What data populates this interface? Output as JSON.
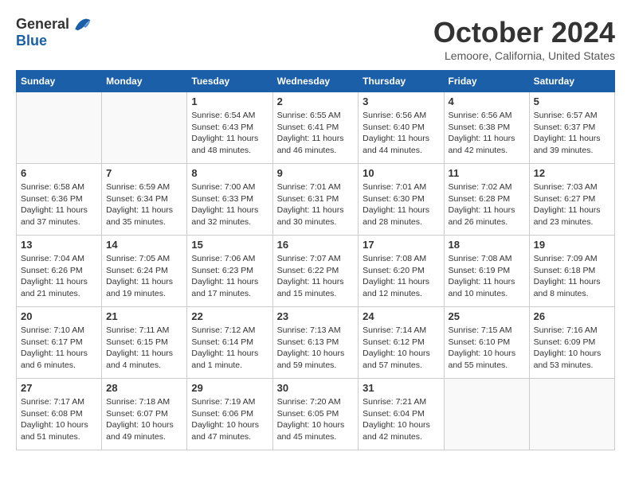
{
  "logo": {
    "general": "General",
    "blue": "Blue"
  },
  "title": "October 2024",
  "location": "Lemoore, California, United States",
  "days_of_week": [
    "Sunday",
    "Monday",
    "Tuesday",
    "Wednesday",
    "Thursday",
    "Friday",
    "Saturday"
  ],
  "weeks": [
    [
      {
        "day": "",
        "info": ""
      },
      {
        "day": "",
        "info": ""
      },
      {
        "day": "1",
        "info": "Sunrise: 6:54 AM\nSunset: 6:43 PM\nDaylight: 11 hours\nand 48 minutes."
      },
      {
        "day": "2",
        "info": "Sunrise: 6:55 AM\nSunset: 6:41 PM\nDaylight: 11 hours\nand 46 minutes."
      },
      {
        "day": "3",
        "info": "Sunrise: 6:56 AM\nSunset: 6:40 PM\nDaylight: 11 hours\nand 44 minutes."
      },
      {
        "day": "4",
        "info": "Sunrise: 6:56 AM\nSunset: 6:38 PM\nDaylight: 11 hours\nand 42 minutes."
      },
      {
        "day": "5",
        "info": "Sunrise: 6:57 AM\nSunset: 6:37 PM\nDaylight: 11 hours\nand 39 minutes."
      }
    ],
    [
      {
        "day": "6",
        "info": "Sunrise: 6:58 AM\nSunset: 6:36 PM\nDaylight: 11 hours\nand 37 minutes."
      },
      {
        "day": "7",
        "info": "Sunrise: 6:59 AM\nSunset: 6:34 PM\nDaylight: 11 hours\nand 35 minutes."
      },
      {
        "day": "8",
        "info": "Sunrise: 7:00 AM\nSunset: 6:33 PM\nDaylight: 11 hours\nand 32 minutes."
      },
      {
        "day": "9",
        "info": "Sunrise: 7:01 AM\nSunset: 6:31 PM\nDaylight: 11 hours\nand 30 minutes."
      },
      {
        "day": "10",
        "info": "Sunrise: 7:01 AM\nSunset: 6:30 PM\nDaylight: 11 hours\nand 28 minutes."
      },
      {
        "day": "11",
        "info": "Sunrise: 7:02 AM\nSunset: 6:28 PM\nDaylight: 11 hours\nand 26 minutes."
      },
      {
        "day": "12",
        "info": "Sunrise: 7:03 AM\nSunset: 6:27 PM\nDaylight: 11 hours\nand 23 minutes."
      }
    ],
    [
      {
        "day": "13",
        "info": "Sunrise: 7:04 AM\nSunset: 6:26 PM\nDaylight: 11 hours\nand 21 minutes."
      },
      {
        "day": "14",
        "info": "Sunrise: 7:05 AM\nSunset: 6:24 PM\nDaylight: 11 hours\nand 19 minutes."
      },
      {
        "day": "15",
        "info": "Sunrise: 7:06 AM\nSunset: 6:23 PM\nDaylight: 11 hours\nand 17 minutes."
      },
      {
        "day": "16",
        "info": "Sunrise: 7:07 AM\nSunset: 6:22 PM\nDaylight: 11 hours\nand 15 minutes."
      },
      {
        "day": "17",
        "info": "Sunrise: 7:08 AM\nSunset: 6:20 PM\nDaylight: 11 hours\nand 12 minutes."
      },
      {
        "day": "18",
        "info": "Sunrise: 7:08 AM\nSunset: 6:19 PM\nDaylight: 11 hours\nand 10 minutes."
      },
      {
        "day": "19",
        "info": "Sunrise: 7:09 AM\nSunset: 6:18 PM\nDaylight: 11 hours\nand 8 minutes."
      }
    ],
    [
      {
        "day": "20",
        "info": "Sunrise: 7:10 AM\nSunset: 6:17 PM\nDaylight: 11 hours\nand 6 minutes."
      },
      {
        "day": "21",
        "info": "Sunrise: 7:11 AM\nSunset: 6:15 PM\nDaylight: 11 hours\nand 4 minutes."
      },
      {
        "day": "22",
        "info": "Sunrise: 7:12 AM\nSunset: 6:14 PM\nDaylight: 11 hours\nand 1 minute."
      },
      {
        "day": "23",
        "info": "Sunrise: 7:13 AM\nSunset: 6:13 PM\nDaylight: 10 hours\nand 59 minutes."
      },
      {
        "day": "24",
        "info": "Sunrise: 7:14 AM\nSunset: 6:12 PM\nDaylight: 10 hours\nand 57 minutes."
      },
      {
        "day": "25",
        "info": "Sunrise: 7:15 AM\nSunset: 6:10 PM\nDaylight: 10 hours\nand 55 minutes."
      },
      {
        "day": "26",
        "info": "Sunrise: 7:16 AM\nSunset: 6:09 PM\nDaylight: 10 hours\nand 53 minutes."
      }
    ],
    [
      {
        "day": "27",
        "info": "Sunrise: 7:17 AM\nSunset: 6:08 PM\nDaylight: 10 hours\nand 51 minutes."
      },
      {
        "day": "28",
        "info": "Sunrise: 7:18 AM\nSunset: 6:07 PM\nDaylight: 10 hours\nand 49 minutes."
      },
      {
        "day": "29",
        "info": "Sunrise: 7:19 AM\nSunset: 6:06 PM\nDaylight: 10 hours\nand 47 minutes."
      },
      {
        "day": "30",
        "info": "Sunrise: 7:20 AM\nSunset: 6:05 PM\nDaylight: 10 hours\nand 45 minutes."
      },
      {
        "day": "31",
        "info": "Sunrise: 7:21 AM\nSunset: 6:04 PM\nDaylight: 10 hours\nand 42 minutes."
      },
      {
        "day": "",
        "info": ""
      },
      {
        "day": "",
        "info": ""
      }
    ]
  ]
}
